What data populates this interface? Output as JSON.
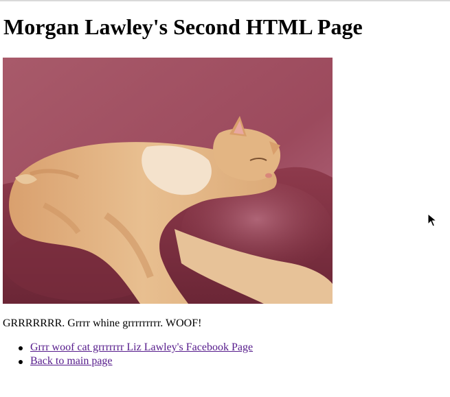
{
  "page": {
    "heading": "Morgan Lawley's Second HTML Page",
    "paragraph": "GRRRRRRR. Grrrr whine grrrrrrrrr. WOOF!"
  },
  "image": {
    "subject": "orange tabby cat sleeping on a burgundy leather couch"
  },
  "links": [
    {
      "label": "Grrr woof cat grrrrrrr Liz Lawley's Facebook Page"
    },
    {
      "label": "Back to main page"
    }
  ],
  "colors": {
    "link_color": "#551a8b",
    "couch": "#8a3948",
    "cat_fur": "#e6b888"
  },
  "icons": {
    "cursor": "mouse-pointer-icon"
  }
}
